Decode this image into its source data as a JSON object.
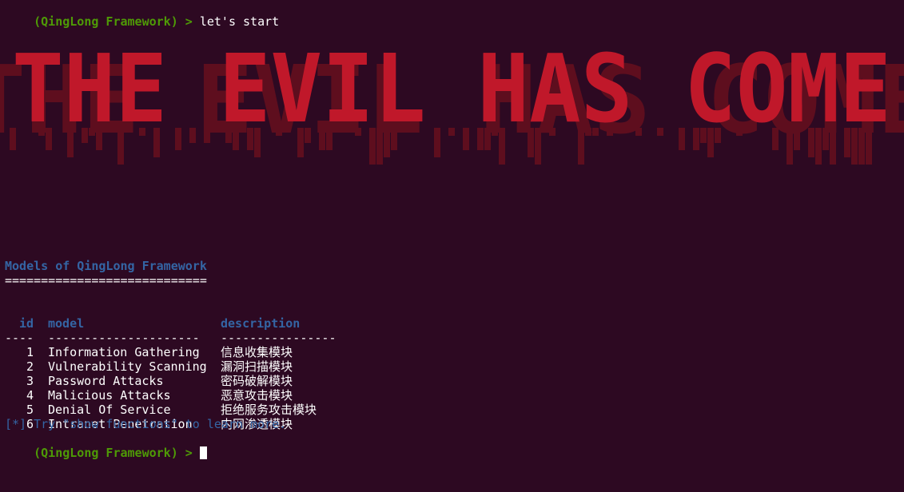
{
  "terminal": {
    "prompt": "(QingLong Framework) > ",
    "first_command": "let's start",
    "banner_text": "THE EVIL HAS COME",
    "colors": {
      "background": "#2d0922",
      "prompt": "#4e9a06",
      "heading": "#3465a4",
      "banner_bright": "#c0182a",
      "banner_dark": "#5e0e1e"
    }
  },
  "models": {
    "title": "Models of QingLong Framework",
    "underline": "============================",
    "headers": {
      "id": "id",
      "model": "model",
      "description": "description"
    },
    "separators": {
      "id": "----",
      "model": "---------------------",
      "description": "----------------"
    },
    "rows": [
      {
        "id": "1",
        "model": "Information Gathering",
        "description": "信息收集模块"
      },
      {
        "id": "2",
        "model": "Vulnerability Scanning",
        "description": "漏洞扫描模块"
      },
      {
        "id": "3",
        "model": "Password Attacks",
        "description": "密码破解模块"
      },
      {
        "id": "4",
        "model": "Malicious Attacks",
        "description": "恶意攻击模块"
      },
      {
        "id": "5",
        "model": "Denial Of Service",
        "description": "拒绝服务攻击模块"
      },
      {
        "id": "6",
        "model": "Intranet Penetration",
        "description": "内网渗透模块"
      }
    ],
    "hint": "[*] Try \"show functions\" to learn more."
  }
}
